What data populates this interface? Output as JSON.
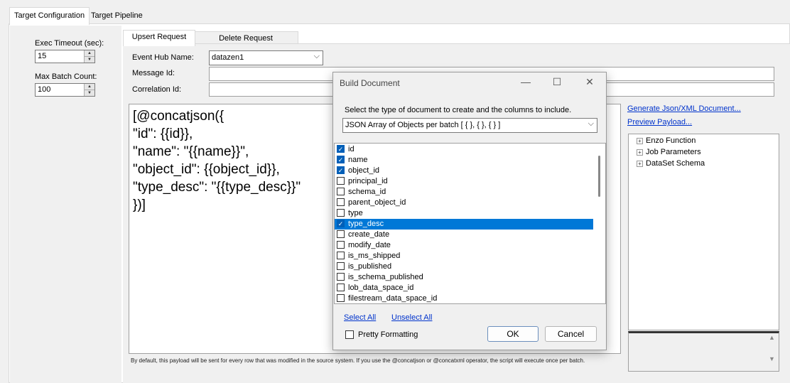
{
  "tabs": [
    {
      "label": "Target Configuration",
      "active": true
    },
    {
      "label": "Target Pipeline",
      "active": false
    }
  ],
  "left": {
    "exec_timeout_label": "Exec Timeout (sec):",
    "exec_timeout_value": "15",
    "max_batch_label": "Max Batch Count:",
    "max_batch_value": "100"
  },
  "request_tabs": [
    {
      "label": "Upsert Request",
      "active": true
    },
    {
      "label": "Delete Request",
      "active": false
    }
  ],
  "form": {
    "event_hub_label": "Event Hub Name:",
    "event_hub_value": "datazen1",
    "message_id_label": "Message Id:",
    "message_id_value": "",
    "correlation_id_label": "Correlation Id:",
    "correlation_id_value": ""
  },
  "editor": {
    "lines": [
      "[@concatjson({",
      "\"id\": {{id}},",
      "\"name\": \"{{name}}\",",
      "\"object_id\": {{object_id}},",
      "\"type_desc\": \"{{type_desc}}\"",
      " })]"
    ]
  },
  "links": {
    "generate": "Generate Json/XML Document...",
    "preview": "Preview Payload..."
  },
  "tree": {
    "items": [
      "Enzo Function",
      "Job Parameters",
      "DataSet Schema"
    ]
  },
  "footnote": "By default, this payload will be sent for every row that was modified in the source system.  If you use the @concatjson or @concatxml operator, the script will execute once per batch.",
  "dialog": {
    "title": "Build Document",
    "window_buttons": {
      "minimize": "—",
      "maximize": "☐",
      "close": "✕"
    },
    "instruction": "Select the type of document to create and the columns to include.",
    "doc_type": "JSON Array of Objects per batch  [ { }, { }, { } ]",
    "columns": [
      {
        "name": "id",
        "checked": true,
        "selected": false
      },
      {
        "name": "name",
        "checked": true,
        "selected": false
      },
      {
        "name": "object_id",
        "checked": true,
        "selected": false
      },
      {
        "name": "principal_id",
        "checked": false,
        "selected": false
      },
      {
        "name": "schema_id",
        "checked": false,
        "selected": false
      },
      {
        "name": "parent_object_id",
        "checked": false,
        "selected": false
      },
      {
        "name": "type",
        "checked": false,
        "selected": false
      },
      {
        "name": "type_desc",
        "checked": true,
        "selected": true
      },
      {
        "name": "create_date",
        "checked": false,
        "selected": false
      },
      {
        "name": "modify_date",
        "checked": false,
        "selected": false
      },
      {
        "name": "is_ms_shipped",
        "checked": false,
        "selected": false
      },
      {
        "name": "is_published",
        "checked": false,
        "selected": false
      },
      {
        "name": "is_schema_published",
        "checked": false,
        "selected": false
      },
      {
        "name": "lob_data_space_id",
        "checked": false,
        "selected": false
      },
      {
        "name": "filestream_data_space_id",
        "checked": false,
        "selected": false
      }
    ],
    "select_all": "Select All",
    "unselect_all": "Unselect All",
    "pretty_formatting": "Pretty Formatting",
    "pretty_checked": false,
    "ok": "OK",
    "cancel": "Cancel"
  },
  "colors": {
    "selection": "#0078d7",
    "link": "#0033cc"
  }
}
